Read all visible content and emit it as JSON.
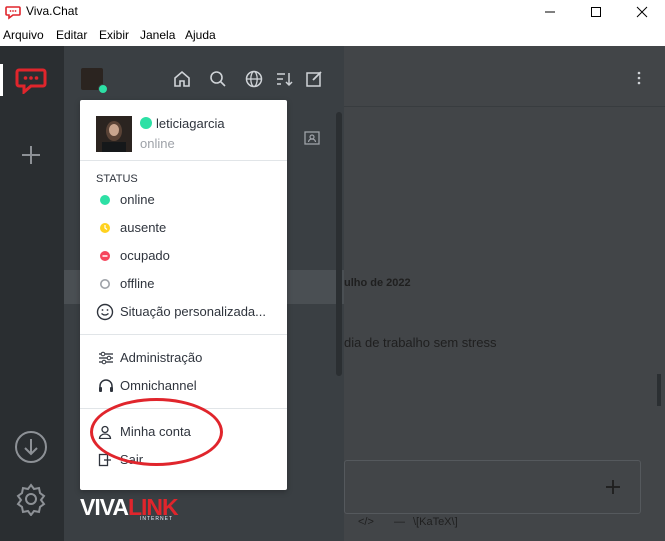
{
  "window": {
    "title": "Viva.Chat"
  },
  "menubar": {
    "items": [
      "Arquivo",
      "Editar",
      "Exibir",
      "Janela",
      "Ajuda"
    ]
  },
  "brand": {
    "name": "VIVALINK",
    "sub": "INTERNET"
  },
  "main": {
    "date": "ulho de 2022",
    "message": "dia de trabalho sem stress",
    "toolbar_snippet": "\\[KaTeX\\]"
  },
  "dropdown": {
    "user": {
      "name": "leticiagarcia",
      "status": "online"
    },
    "status_title": "STATUS",
    "status_items": [
      {
        "label": "online",
        "color": "#2de0a5"
      },
      {
        "label": "ausente",
        "color": "#ffd21f"
      },
      {
        "label": "ocupado",
        "color": "#f5455c"
      },
      {
        "label": "offline",
        "color": "#9ea2a8"
      },
      {
        "label": "Situação personalizada..."
      }
    ],
    "admin_items": [
      {
        "label": "Administração"
      },
      {
        "label": "Omnichannel"
      }
    ],
    "account_items": [
      {
        "label": "Minha conta"
      },
      {
        "label": "Sair"
      }
    ]
  },
  "colors": {
    "accent_red": "#e0252c",
    "brand_red": "#e0252c"
  }
}
